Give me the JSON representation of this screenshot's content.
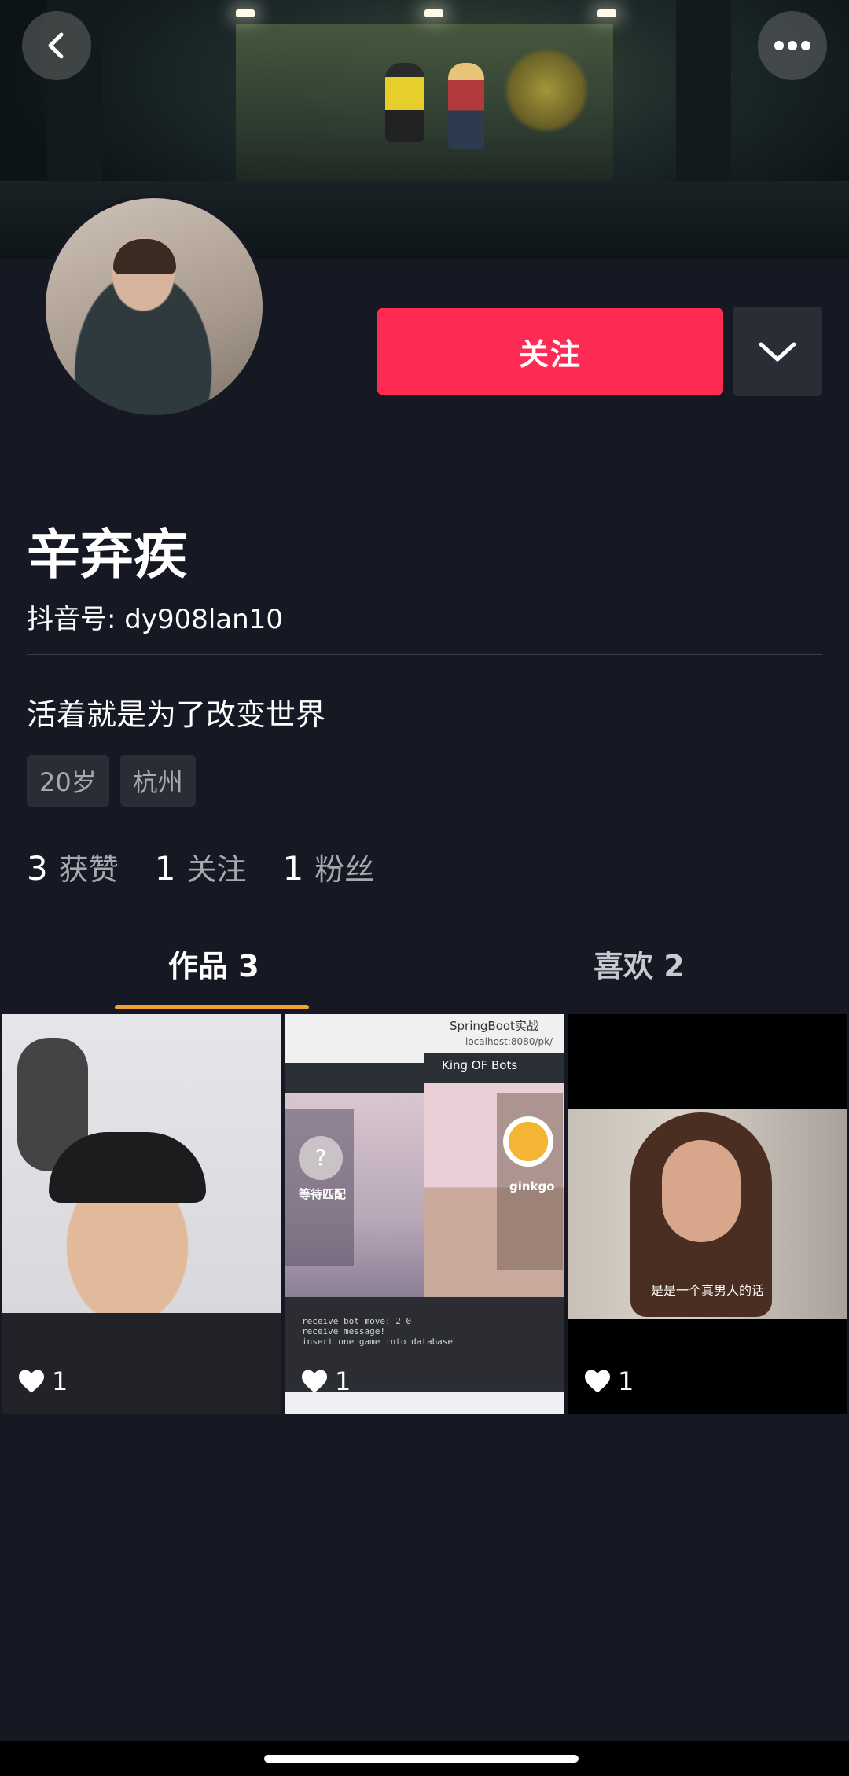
{
  "header": {
    "back_icon": "chevron-left-icon",
    "more_icon": "more-dots-icon"
  },
  "profile": {
    "name": "辛弃疾",
    "account_label": "抖音号: dy908lan10",
    "bio": "活着就是为了改变世界",
    "tags": [
      "20岁",
      "杭州"
    ],
    "follow_button": "关注",
    "dropdown_icon": "chevron-down-icon"
  },
  "stats": [
    {
      "value": "3",
      "label": "获赞"
    },
    {
      "value": "1",
      "label": "关注"
    },
    {
      "value": "1",
      "label": "粉丝"
    }
  ],
  "tabs": [
    {
      "label": "作品 3",
      "active": true
    },
    {
      "label": "喜欢 2",
      "active": false
    }
  ],
  "videos": [
    {
      "likes": "1"
    },
    {
      "likes": "1",
      "screen_texts": {
        "window_title": "SpringBoot实战",
        "address": "localhost:8080/pk/",
        "app_title": "King OF Bots",
        "waiting": "等待匹配",
        "player": "ginkgo",
        "console_lines": [
          "receive bot move: 2 0",
          "receive message!",
          "insert one game into database"
        ]
      }
    },
    {
      "likes": "1",
      "subtitle": "是是一个真男人的话"
    }
  ],
  "colors": {
    "background": "#161823",
    "follow": "#fe2c55",
    "tab_indicator": "#f2a134",
    "muted_text": "#a8a9b0"
  }
}
